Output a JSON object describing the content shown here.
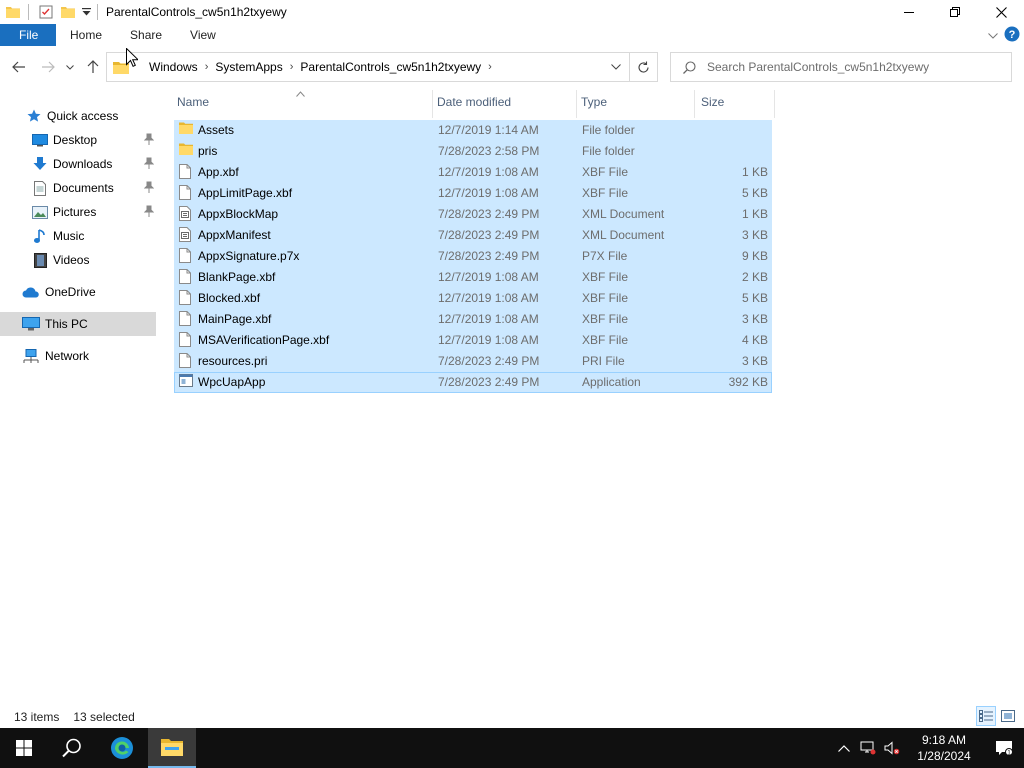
{
  "window": {
    "title": "ParentalControls_cw5n1h2txyewy"
  },
  "ribbon": {
    "tabs": [
      "File",
      "Home",
      "Share",
      "View"
    ]
  },
  "address": {
    "crumbs": [
      "Windows",
      "SystemApps",
      "ParentalControls_cw5n1h2txyewy"
    ]
  },
  "search": {
    "placeholder": "Search ParentalControls_cw5n1h2txyewy"
  },
  "sidebar": {
    "items": [
      {
        "label": "Quick access",
        "icon": "star-icon"
      },
      {
        "label": "Desktop",
        "icon": "desktop-icon",
        "pinned": true
      },
      {
        "label": "Downloads",
        "icon": "downloads-icon",
        "pinned": true
      },
      {
        "label": "Documents",
        "icon": "documents-icon",
        "pinned": true
      },
      {
        "label": "Pictures",
        "icon": "pictures-icon",
        "pinned": true
      },
      {
        "label": "Music",
        "icon": "music-icon"
      },
      {
        "label": "Videos",
        "icon": "videos-icon"
      },
      {
        "label": "OneDrive",
        "icon": "cloud-icon"
      },
      {
        "label": "This PC",
        "icon": "computer-icon",
        "selected": true
      },
      {
        "label": "Network",
        "icon": "network-icon"
      }
    ]
  },
  "columns": {
    "name": "Name",
    "date": "Date modified",
    "type": "Type",
    "size": "Size"
  },
  "files": [
    {
      "name": "Assets",
      "date": "12/7/2019 1:14 AM",
      "type": "File folder",
      "size": "",
      "icon": "folder-icon"
    },
    {
      "name": "pris",
      "date": "7/28/2023 2:58 PM",
      "type": "File folder",
      "size": "",
      "icon": "folder-icon"
    },
    {
      "name": "App.xbf",
      "date": "12/7/2019 1:08 AM",
      "type": "XBF File",
      "size": "1 KB",
      "icon": "file-icon"
    },
    {
      "name": "AppLimitPage.xbf",
      "date": "12/7/2019 1:08 AM",
      "type": "XBF File",
      "size": "5 KB",
      "icon": "file-icon"
    },
    {
      "name": "AppxBlockMap",
      "date": "7/28/2023 2:49 PM",
      "type": "XML Document",
      "size": "1 KB",
      "icon": "xml-file-icon"
    },
    {
      "name": "AppxManifest",
      "date": "7/28/2023 2:49 PM",
      "type": "XML Document",
      "size": "3 KB",
      "icon": "xml-file-icon"
    },
    {
      "name": "AppxSignature.p7x",
      "date": "7/28/2023 2:49 PM",
      "type": "P7X File",
      "size": "9 KB",
      "icon": "file-icon"
    },
    {
      "name": "BlankPage.xbf",
      "date": "12/7/2019 1:08 AM",
      "type": "XBF File",
      "size": "2 KB",
      "icon": "file-icon"
    },
    {
      "name": "Blocked.xbf",
      "date": "12/7/2019 1:08 AM",
      "type": "XBF File",
      "size": "5 KB",
      "icon": "file-icon"
    },
    {
      "name": "MainPage.xbf",
      "date": "12/7/2019 1:08 AM",
      "type": "XBF File",
      "size": "3 KB",
      "icon": "file-icon"
    },
    {
      "name": "MSAVerificationPage.xbf",
      "date": "12/7/2019 1:08 AM",
      "type": "XBF File",
      "size": "4 KB",
      "icon": "file-icon"
    },
    {
      "name": "resources.pri",
      "date": "7/28/2023 2:49 PM",
      "type": "PRI File",
      "size": "3 KB",
      "icon": "file-icon"
    },
    {
      "name": "WpcUapApp",
      "date": "7/28/2023 2:49 PM",
      "type": "Application",
      "size": "392 KB",
      "icon": "application-icon"
    }
  ],
  "status": {
    "count": "13 items",
    "selected": "13 selected"
  },
  "taskbar": {
    "time": "9:18 AM",
    "date": "1/28/2024"
  },
  "colors": {
    "selection": "#cce8ff",
    "accent": "#1a6fbf",
    "taskbar": "#101010"
  }
}
